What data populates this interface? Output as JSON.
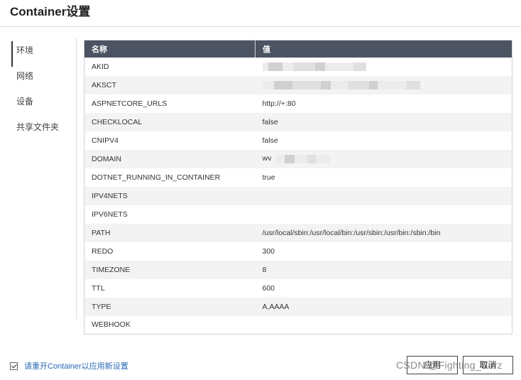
{
  "dialog": {
    "title": "Container设置"
  },
  "sidebar": {
    "items": [
      {
        "label": "环境"
      },
      {
        "label": "网络"
      },
      {
        "label": "设备"
      },
      {
        "label": "共享文件夹"
      }
    ]
  },
  "table": {
    "headers": {
      "name": "名称",
      "value": "值"
    },
    "rows": [
      {
        "name": "AKID",
        "value": ""
      },
      {
        "name": "AKSCT",
        "value": ""
      },
      {
        "name": "ASPNETCORE_URLS",
        "value": "http://+:80"
      },
      {
        "name": "CHECKLOCAL",
        "value": "false"
      },
      {
        "name": "CNIPV4",
        "value": "false"
      },
      {
        "name": "DOMAIN",
        "value": "wv"
      },
      {
        "name": "DOTNET_RUNNING_IN_CONTAINER",
        "value": "true"
      },
      {
        "name": "IPV4NETS",
        "value": ""
      },
      {
        "name": "IPV6NETS",
        "value": ""
      },
      {
        "name": "PATH",
        "value": "/usr/local/sbin:/usr/local/bin:/usr/sbin:/usr/bin:/sbin:/bin"
      },
      {
        "name": "REDO",
        "value": "300"
      },
      {
        "name": "TIMEZONE",
        "value": "8"
      },
      {
        "name": "TTL",
        "value": "600"
      },
      {
        "name": "TYPE",
        "value": "A,AAAA"
      },
      {
        "name": "WEBHOOK",
        "value": ""
      }
    ]
  },
  "footer": {
    "restart_note": "请重开Container以应用新设置",
    "apply_label": "应用",
    "cancel_label": "取消"
  },
  "watermark": "CSDN @Fighting_Sorz",
  "colors": {
    "header_bg": "#4c5362",
    "link": "#2a6ab8"
  }
}
